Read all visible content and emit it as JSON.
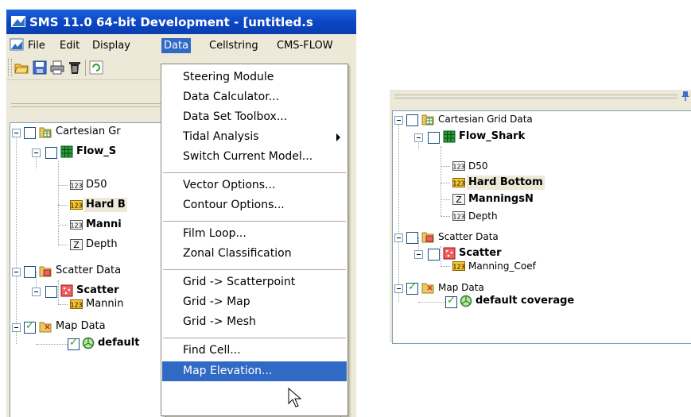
{
  "window": {
    "title": "SMS 11.0 64-bit Development - [untitled.s"
  },
  "menubar": {
    "file": "File",
    "edit": "Edit",
    "display": "Display",
    "data": "Data",
    "cellstring": "Cellstring",
    "cmsflow": "CMS-FLOW"
  },
  "toolbar_icons": [
    "open-folder-icon",
    "save-icon",
    "print-icon",
    "delete-icon",
    "refresh-icon"
  ],
  "data_menu": {
    "items": [
      "Steering Module",
      "Data Calculator...",
      "Data Set Toolbox...",
      "Tidal Analysis",
      "Switch Current Model...",
      "Vector Options...",
      "Contour Options...",
      "Film Loop...",
      "Zonal Classification",
      "Grid -> Scatterpoint",
      "Grid -> Map",
      "Grid -> Mesh",
      "Find Cell...",
      "Map Elevation..."
    ],
    "highlighted": "Map Elevation..."
  },
  "left_tree": {
    "cartesian": "Cartesian Gr",
    "grid": "Flow_S",
    "d50": "D50",
    "hard": "Hard B",
    "mannings": "Manni",
    "depth": "Depth",
    "scatter_data": "Scatter Data",
    "scatter": "Scatter",
    "manning_coef": "Mannin",
    "map_data": "Map Data",
    "coverage": "default"
  },
  "right_tree": {
    "cartesian": "Cartesian Grid Data",
    "grid": "Flow_Shark",
    "d50": "D50",
    "hard": "Hard Bottom",
    "mannings": "ManningsN",
    "depth": "Depth",
    "scatter_data": "Scatter Data",
    "scatter": "Scatter",
    "manning_coef": "Manning_Coef",
    "map_data": "Map Data",
    "coverage": "default coverage"
  },
  "colors": {
    "titlebar": "#0a45c4",
    "menu_highlight": "#316ac5",
    "window_bg": "#ece9d8"
  }
}
